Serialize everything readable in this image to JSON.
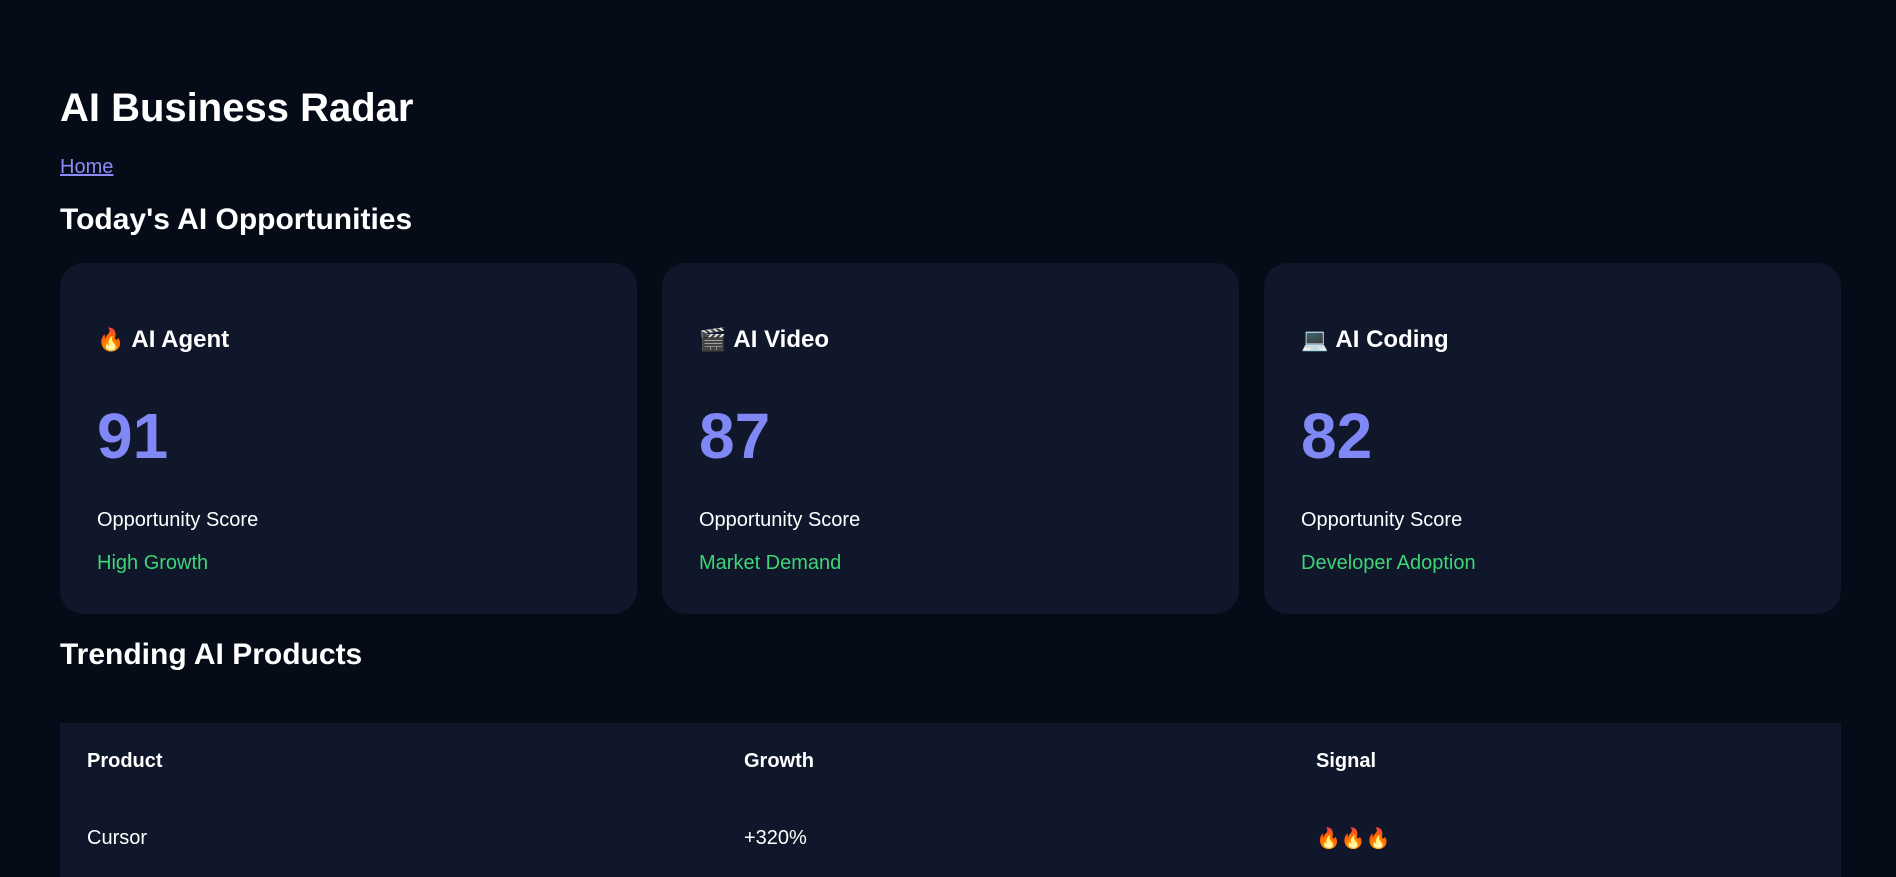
{
  "header": {
    "title": "AI Business Radar",
    "home_link": "Home"
  },
  "opportunities": {
    "title": "Today's AI Opportunities",
    "cards": [
      {
        "icon": "fire-icon",
        "icon_glyph": "🔥",
        "name": "AI Agent",
        "score": "91",
        "label": "Opportunity Score",
        "tag": "High Growth"
      },
      {
        "icon": "clapperboard-icon",
        "icon_glyph": "🎬",
        "name": "AI Video",
        "score": "87",
        "label": "Opportunity Score",
        "tag": "Market Demand"
      },
      {
        "icon": "laptop-icon",
        "icon_glyph": "💻",
        "name": "AI Coding",
        "score": "82",
        "label": "Opportunity Score",
        "tag": "Developer Adoption"
      }
    ]
  },
  "trending": {
    "title": "Trending AI Products",
    "columns": [
      "Product",
      "Growth",
      "Signal"
    ],
    "rows": [
      {
        "product": "Cursor",
        "growth": "+320%",
        "signal": "🔥🔥🔥"
      }
    ]
  },
  "colors": {
    "background": "#060b18",
    "card": "#10172b",
    "score": "#7f88f4",
    "tag": "#3fd378",
    "link": "#8b8cf8"
  }
}
